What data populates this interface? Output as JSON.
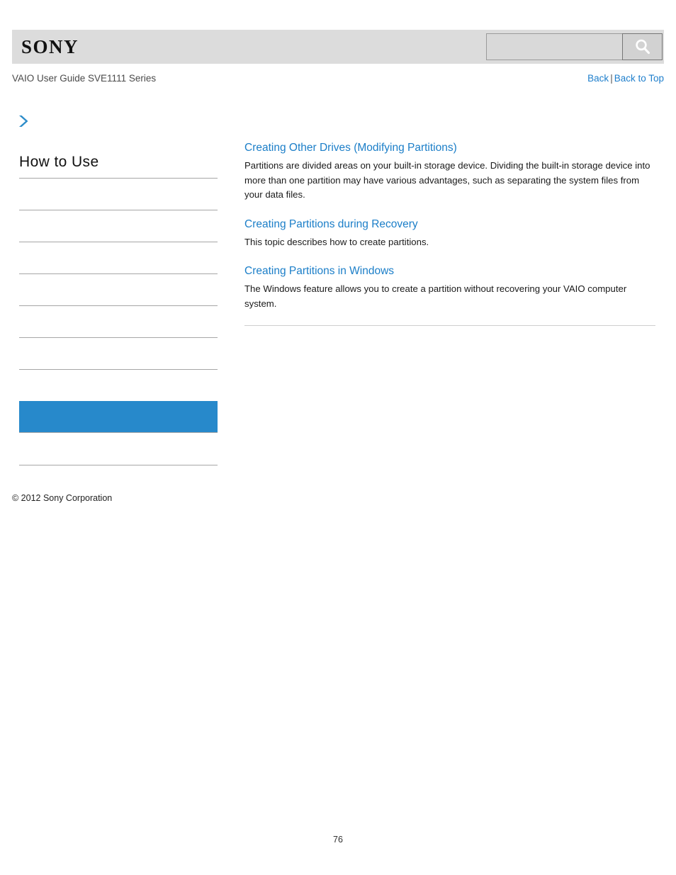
{
  "header": {
    "logo_text": "SONY",
    "search": {
      "value": "",
      "placeholder": "",
      "icon": "search-icon",
      "button_label": ""
    },
    "breadcrumb_title": "VAIO User Guide SVE1111 Series",
    "links": {
      "back": "Back",
      "separator": "|",
      "back_to_top": "Back to Top"
    }
  },
  "sidebar": {
    "marker_icon": "chevron-right-icon",
    "title": "How to Use",
    "items": [
      {
        "label": "",
        "selected": false
      },
      {
        "label": "",
        "selected": false
      },
      {
        "label": "",
        "selected": false
      },
      {
        "label": "",
        "selected": false
      },
      {
        "label": "",
        "selected": false
      },
      {
        "label": "",
        "selected": false
      },
      {
        "label": "",
        "selected": false
      },
      {
        "label": "",
        "selected": true
      },
      {
        "label": "",
        "selected": false
      }
    ],
    "copyright": "© 2012 Sony Corporation"
  },
  "main": {
    "topics": [
      {
        "title": "Creating Other Drives (Modifying Partitions)",
        "description": "Partitions are divided areas on your built-in storage device. Dividing the built-in storage device into more than one partition may have various advantages, such as separating the system files from your data files."
      },
      {
        "title": "Creating Partitions during Recovery",
        "description": "This topic describes how to create partitions."
      },
      {
        "title": "Creating Partitions in Windows",
        "description": "The Windows feature allows you to create a partition without recovering your VAIO computer system."
      }
    ]
  },
  "footer": {
    "page_number": "76"
  },
  "colors": {
    "accent_blue": "#2789cb",
    "link_blue": "#1b7ec8",
    "header_gray": "#dcdcdc",
    "divider_gray": "#a6a6a6"
  }
}
